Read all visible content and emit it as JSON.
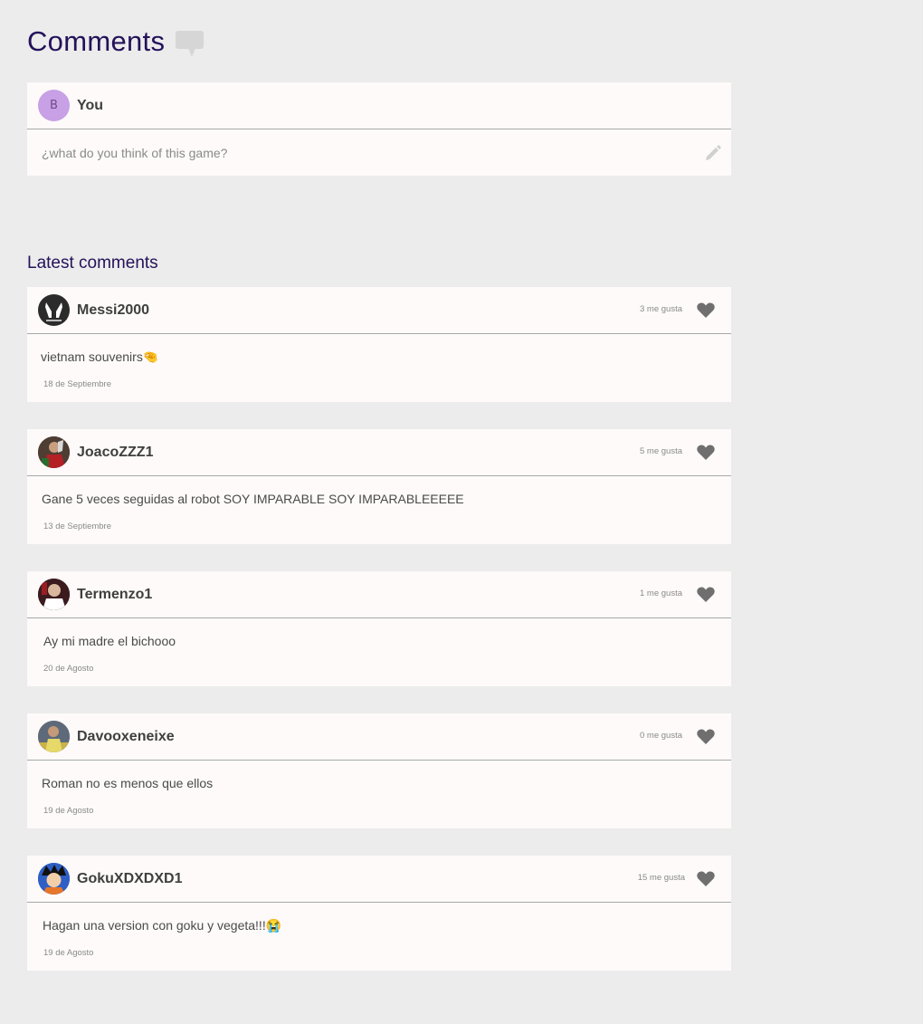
{
  "header": {
    "title": "Comments",
    "icon": "speech-bubble-icon"
  },
  "compose": {
    "avatar_letter": "B",
    "user_label": "You",
    "placeholder": "¿what do you think of this game?",
    "icon": "pencil-icon",
    "avatar_color": "#c7a0e6"
  },
  "latest": {
    "title": "Latest comments"
  },
  "comments": [
    {
      "username": "Messi2000",
      "likes_label": "3 me gusta",
      "text": "vietnam souvenirs🤏",
      "date": "18 de Septiembre",
      "avatar": "messi-logo-avatar"
    },
    {
      "username": "JoacoZZZ1",
      "likes_label": "5 me gusta",
      "text": "Gane 5 veces seguidas al robot SOY IMPARABLE SOY IMPARABLEEEEE",
      "date": "13 de Septiembre",
      "avatar": "player-trophy-avatar"
    },
    {
      "username": "Termenzo1",
      "likes_label": "1 me gusta",
      "text": "Ay mi madre el bichooo",
      "date": "20 de Agosto",
      "avatar": "player-portrait-avatar"
    },
    {
      "username": "Davooxeneixe",
      "likes_label": "0 me gusta",
      "text": "Roman no es menos que ellos",
      "date": "19 de Agosto",
      "avatar": "player-stadium-avatar"
    },
    {
      "username": "GokuXDXDXD1",
      "likes_label": "15 me gusta",
      "text": "Hagan una version con goku y vegeta!!!😭",
      "date": "19 de Agosto",
      "avatar": "goku-avatar"
    }
  ],
  "colors": {
    "background": "#ececec",
    "card": "#fdfaf9",
    "title": "#24125a",
    "heart": "#6f6f6f"
  }
}
